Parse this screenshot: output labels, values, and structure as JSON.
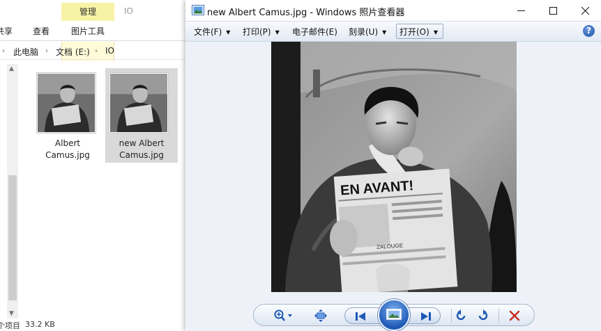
{
  "explorer": {
    "ribbon": {
      "context_group": "管理",
      "context_folder": "IO",
      "tabs": [
        "共享",
        "查看"
      ],
      "context_tab": "图片工具"
    },
    "address": {
      "crumbs": [
        "此电脑",
        "文档 (E:)",
        "IO"
      ]
    },
    "files": [
      {
        "name_line1": "Albert",
        "name_line2": "Camus.jpg",
        "selected": false
      },
      {
        "name_line1": "new Albert",
        "name_line2": "Camus.jpg",
        "selected": true
      }
    ],
    "status": {
      "items": "个项目",
      "size": "33.2 KB"
    }
  },
  "viewer": {
    "title": "new Albert Camus.jpg - Windows 照片查看器",
    "window_controls": [
      "minimize",
      "maximize",
      "close"
    ],
    "menu": {
      "file": "文件(F)",
      "print": "打印(P)",
      "email": "电子邮件(E)",
      "burn": "刻录(U)",
      "open": "打开(O)"
    },
    "photo_text": {
      "headline": "EN AVANT!",
      "subline": "ZALOUGE"
    },
    "toolbar": {
      "icons": [
        "zoom-icon",
        "actual-size-icon",
        "previous-icon",
        "slideshow-icon",
        "next-icon",
        "rotate-left-icon",
        "rotate-right-icon",
        "delete-icon"
      ]
    },
    "colors": {
      "menubar": "#e3eaf4",
      "canvas": "#eef2f8",
      "accent": "#1d58b5",
      "delete": "#c42b1c",
      "context_tab": "#f6f3a6"
    }
  }
}
